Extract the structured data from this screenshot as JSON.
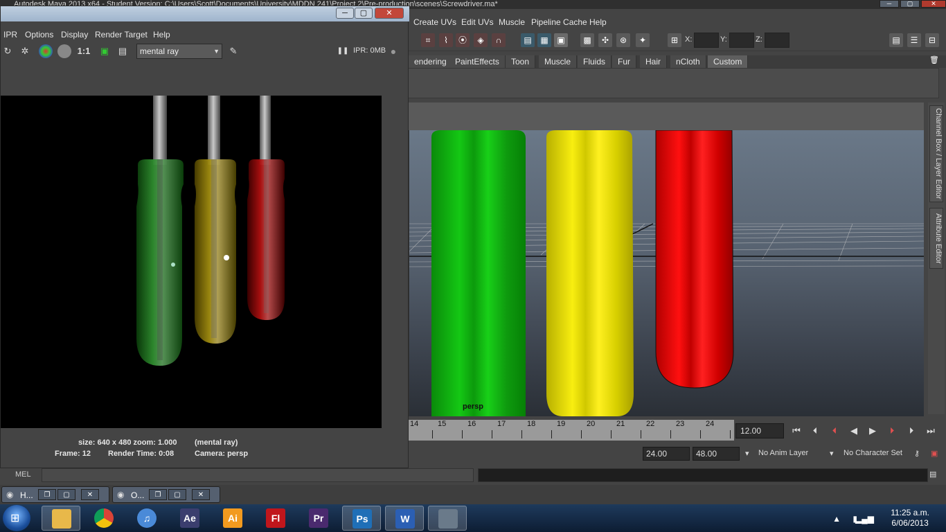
{
  "maya": {
    "title": "Autodesk Maya 2013 x64 - Student Version: C:\\Users\\Scott\\Documents\\University\\MDDN 241\\Project 2\\Pre-production\\scenes\\Screwdriver.ma*",
    "menu": [
      "Create UVs",
      "Edit UVs",
      "Muscle",
      "Pipeline Cache",
      "Help"
    ],
    "coords": {
      "x_label": "X:",
      "y_label": "Y:",
      "z_label": "Z:"
    },
    "shelf_tabs": [
      "endering",
      "PaintEffects",
      "Toon",
      "Muscle",
      "Fluids",
      "Fur",
      "Hair",
      "nCloth",
      "Custom"
    ],
    "side_tabs": {
      "channel_box": "Channel Box / Layer Editor",
      "attribute_editor": "Attribute Editor"
    },
    "viewport_label": "persp",
    "timeline": {
      "ticks": [
        "14",
        "15",
        "16",
        "17",
        "18",
        "19",
        "20",
        "21",
        "22",
        "23",
        "24"
      ],
      "current_frame": "12.00"
    },
    "range": {
      "end": "24.00",
      "total": "48.00",
      "anim_layer": "No Anim Layer",
      "character_set": "No Character Set"
    },
    "command_line": {
      "label": "MEL"
    },
    "minimized_windows": [
      {
        "label": "H..."
      },
      {
        "label": "O..."
      }
    ]
  },
  "render_view": {
    "menu": [
      "IPR",
      "Options",
      "Display",
      "Render Target",
      "Help"
    ],
    "ratio_label": "1:1",
    "renderer": "mental ray",
    "ipr_status": "IPR: 0MB",
    "info": {
      "size_zoom": "size: 640 x 480 zoom: 1.000",
      "renderer": "(mental ray)",
      "frame": "Frame: 12",
      "render_time": "Render Time: 0:08",
      "camera": "Camera: persp"
    }
  },
  "taskbar": {
    "apps": [
      {
        "name": "explorer",
        "glyph": "",
        "color": "#e8b84a"
      },
      {
        "name": "chrome",
        "glyph": "",
        "color": "#db4437"
      },
      {
        "name": "itunes",
        "glyph": "♫",
        "color": "#4a8ad8"
      },
      {
        "name": "after-effects",
        "glyph": "Ae",
        "color": "#3b3e6e"
      },
      {
        "name": "illustrator",
        "glyph": "Ai",
        "color": "#f29a1f"
      },
      {
        "name": "flash",
        "glyph": "Fl",
        "color": "#c0161c"
      },
      {
        "name": "premiere",
        "glyph": "Pr",
        "color": "#4a2a6e"
      },
      {
        "name": "photoshop",
        "glyph": "Ps",
        "color": "#1f6fb7"
      },
      {
        "name": "word",
        "glyph": "W",
        "color": "#2b5fb4"
      },
      {
        "name": "maya",
        "glyph": "",
        "color": "#6a7a8a"
      }
    ],
    "time": "11:25 a.m.",
    "date": "6/06/2013"
  }
}
